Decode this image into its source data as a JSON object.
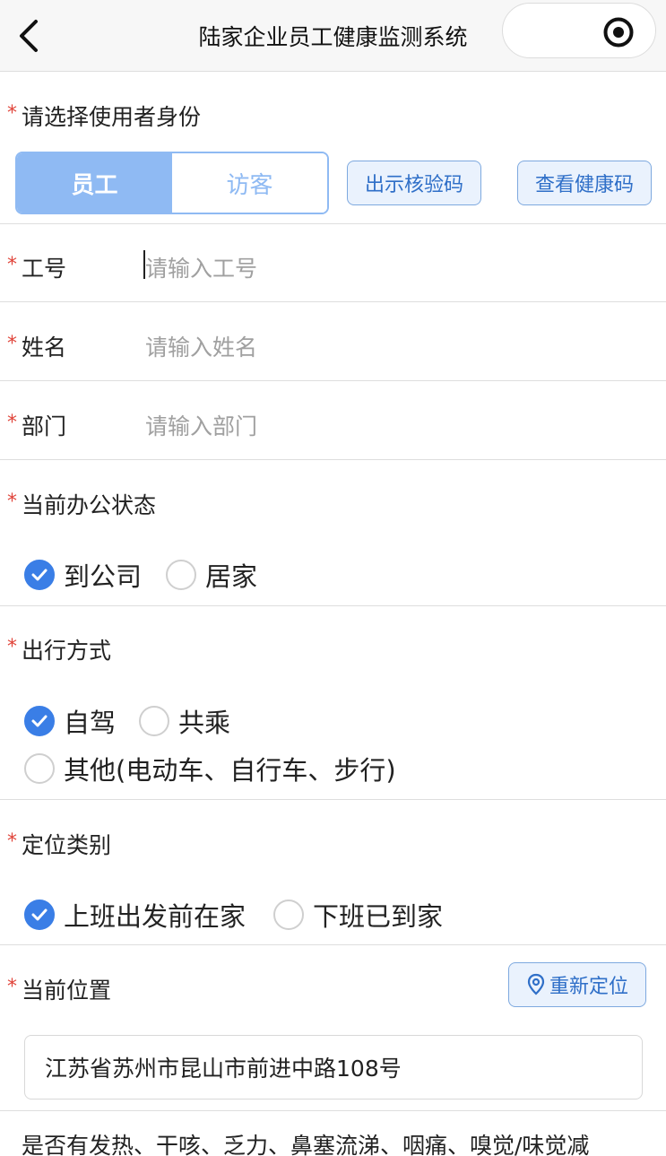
{
  "header": {
    "title": "陆家企业员工健康监测系统"
  },
  "identity": {
    "label": "请选择使用者身份",
    "options": [
      "员工",
      "访客"
    ],
    "selected": "员工",
    "show_code_button": "出示核验码",
    "view_health_code_button": "查看健康码"
  },
  "fields": {
    "employee_id": {
      "label": "工号",
      "placeholder": "请输入工号"
    },
    "name": {
      "label": "姓名",
      "placeholder": "请输入姓名"
    },
    "department": {
      "label": "部门",
      "placeholder": "请输入部门"
    }
  },
  "office_status": {
    "label": "当前办公状态",
    "options": [
      "到公司",
      "居家"
    ],
    "selected": "到公司"
  },
  "travel_mode": {
    "label": "出行方式",
    "options": [
      "自驾",
      "共乘",
      "其他(电动车、自行车、步行)"
    ],
    "selected": "自驾"
  },
  "location_type": {
    "label": "定位类别",
    "options": [
      "上班出发前在家",
      "下班已到家"
    ],
    "selected": "上班出发前在家"
  },
  "current_location": {
    "label": "当前位置",
    "relocate_button": "重新定位",
    "address": "江苏省苏州市昆山市前进中路108号"
  },
  "symptoms_question": "是否有发热、干咳、乏力、鼻塞流涕、咽痛、嗅觉/味觉减",
  "colors": {
    "accent": "#3a7ee6",
    "segment": "#8fbaf3",
    "required": "#e0443a"
  }
}
